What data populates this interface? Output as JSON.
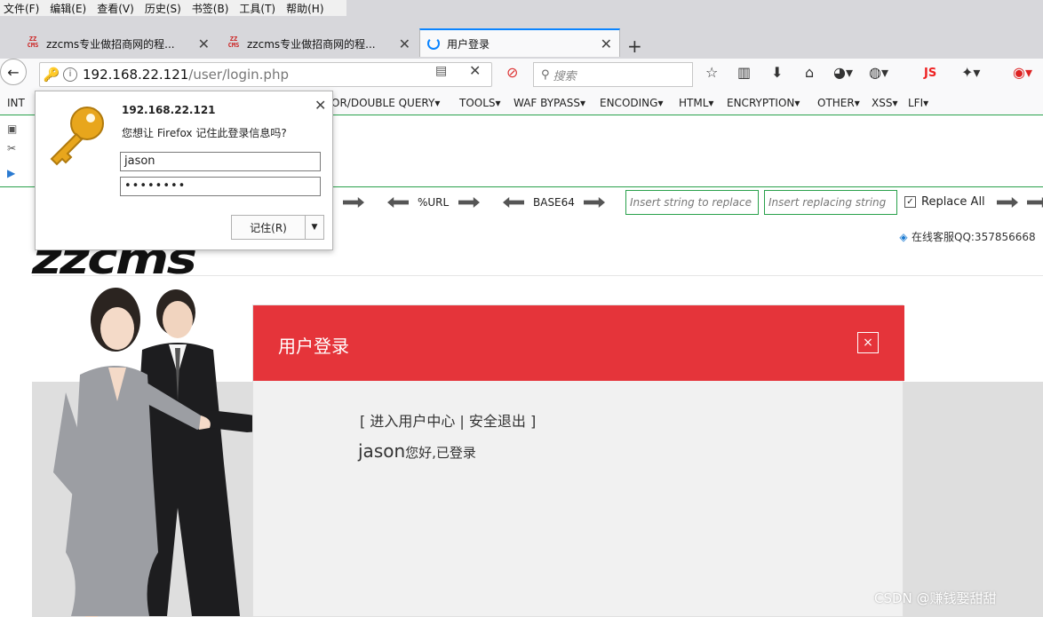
{
  "menubar": {
    "items": [
      "文件(F)",
      "编辑(E)",
      "查看(V)",
      "历史(S)",
      "书签(B)",
      "工具(T)",
      "帮助(H)"
    ]
  },
  "tabs": [
    {
      "title": "zzcms专业做招商网的程...",
      "favicon": "zzcms-icon",
      "active": false
    },
    {
      "title": "zzcms专业做招商网的程...",
      "favicon": "zzcms-icon",
      "active": false
    },
    {
      "title": "用户登录",
      "favicon": "loading-icon",
      "active": true
    }
  ],
  "favicon_text": "ZZ\nCMS",
  "navbar": {
    "url_host": "192.168.22.121",
    "url_path": "/user/login.php",
    "search_placeholder": "搜索",
    "js_label": "JS"
  },
  "hackbar": {
    "int_label": "INT",
    "menu": [
      "OR/DOUBLE QUERY▾",
      "TOOLS▾",
      "WAF BYPASS▾",
      "ENCODING▾",
      "HTML▾",
      "ENCRYPTION▾",
      "OTHER▾",
      "XSS▾",
      "LFI▾"
    ],
    "url_label": "%URL",
    "base64_label": "BASE64",
    "replace_placeholder": "Insert string to replace",
    "replacing_placeholder": "Insert replacing string",
    "replace_all_label": "Replace All"
  },
  "popup": {
    "host": "192.168.22.121",
    "question": "您想让 Firefox 记住此登录信息吗?",
    "username": "jason",
    "password": "••••••••",
    "save_label": "记住(R)"
  },
  "page": {
    "logo": "zzcms",
    "support": "在线客服QQ:357856668",
    "login_title": "用户登录",
    "close_glyph": "×",
    "link_user_center": "进入用户中心",
    "link_logout": "安全退出",
    "welcome_user": "jason",
    "welcome_text": "您好,已登录"
  },
  "watermark": "CSDN @赚钱娶甜甜",
  "colors": {
    "login_header": "#e5343a",
    "hackbar_green": "#29a14b",
    "active_tab_accent": "#0a84ff"
  }
}
